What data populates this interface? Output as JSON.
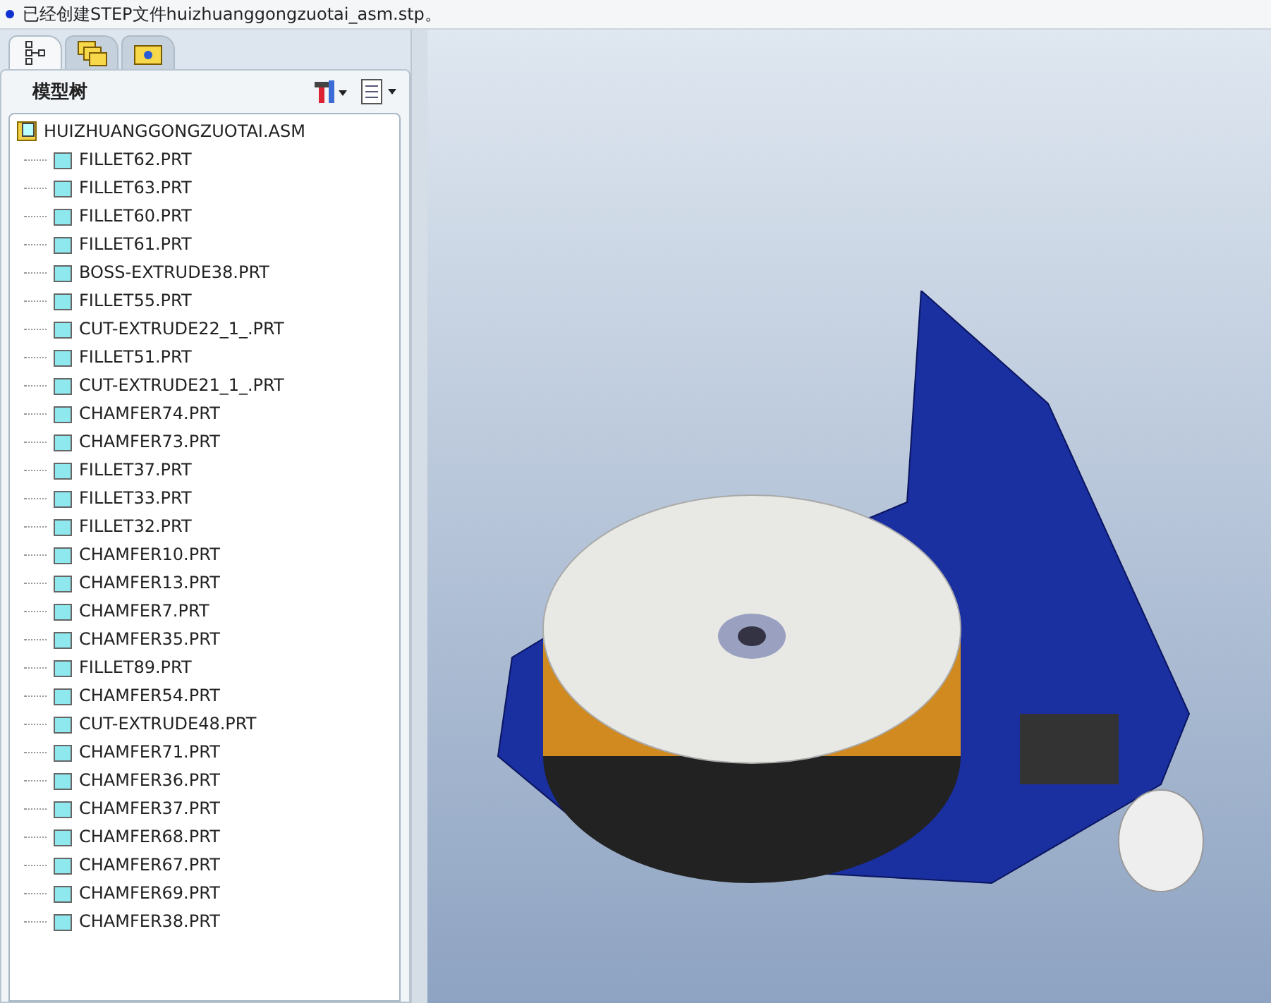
{
  "message_bar": {
    "text": "已经创建STEP文件huizhuanggongzuotai_asm.stp。"
  },
  "tabs": [
    {
      "kind": "tree",
      "selected": true
    },
    {
      "kind": "folders",
      "selected": false
    },
    {
      "kind": "favorites",
      "selected": false
    }
  ],
  "model_tree": {
    "title": "模型树",
    "root": {
      "label": "HUIZHUANGGONGZUOTAI.ASM",
      "children": [
        {
          "label": "FILLET62.PRT"
        },
        {
          "label": "FILLET63.PRT"
        },
        {
          "label": "FILLET60.PRT"
        },
        {
          "label": "FILLET61.PRT"
        },
        {
          "label": "BOSS-EXTRUDE38.PRT"
        },
        {
          "label": "FILLET55.PRT"
        },
        {
          "label": "CUT-EXTRUDE22_1_.PRT"
        },
        {
          "label": "FILLET51.PRT"
        },
        {
          "label": "CUT-EXTRUDE21_1_.PRT"
        },
        {
          "label": "CHAMFER74.PRT"
        },
        {
          "label": "CHAMFER73.PRT"
        },
        {
          "label": "FILLET37.PRT"
        },
        {
          "label": "FILLET33.PRT"
        },
        {
          "label": "FILLET32.PRT"
        },
        {
          "label": "CHAMFER10.PRT"
        },
        {
          "label": "CHAMFER13.PRT"
        },
        {
          "label": "CHAMFER7.PRT"
        },
        {
          "label": "CHAMFER35.PRT"
        },
        {
          "label": "FILLET89.PRT"
        },
        {
          "label": "CHAMFER54.PRT"
        },
        {
          "label": "CUT-EXTRUDE48.PRT"
        },
        {
          "label": "CHAMFER71.PRT"
        },
        {
          "label": "CHAMFER36.PRT"
        },
        {
          "label": "CHAMFER37.PRT"
        },
        {
          "label": "CHAMFER68.PRT"
        },
        {
          "label": "CHAMFER67.PRT"
        },
        {
          "label": "CHAMFER69.PRT"
        },
        {
          "label": "CHAMFER38.PRT"
        }
      ]
    }
  }
}
